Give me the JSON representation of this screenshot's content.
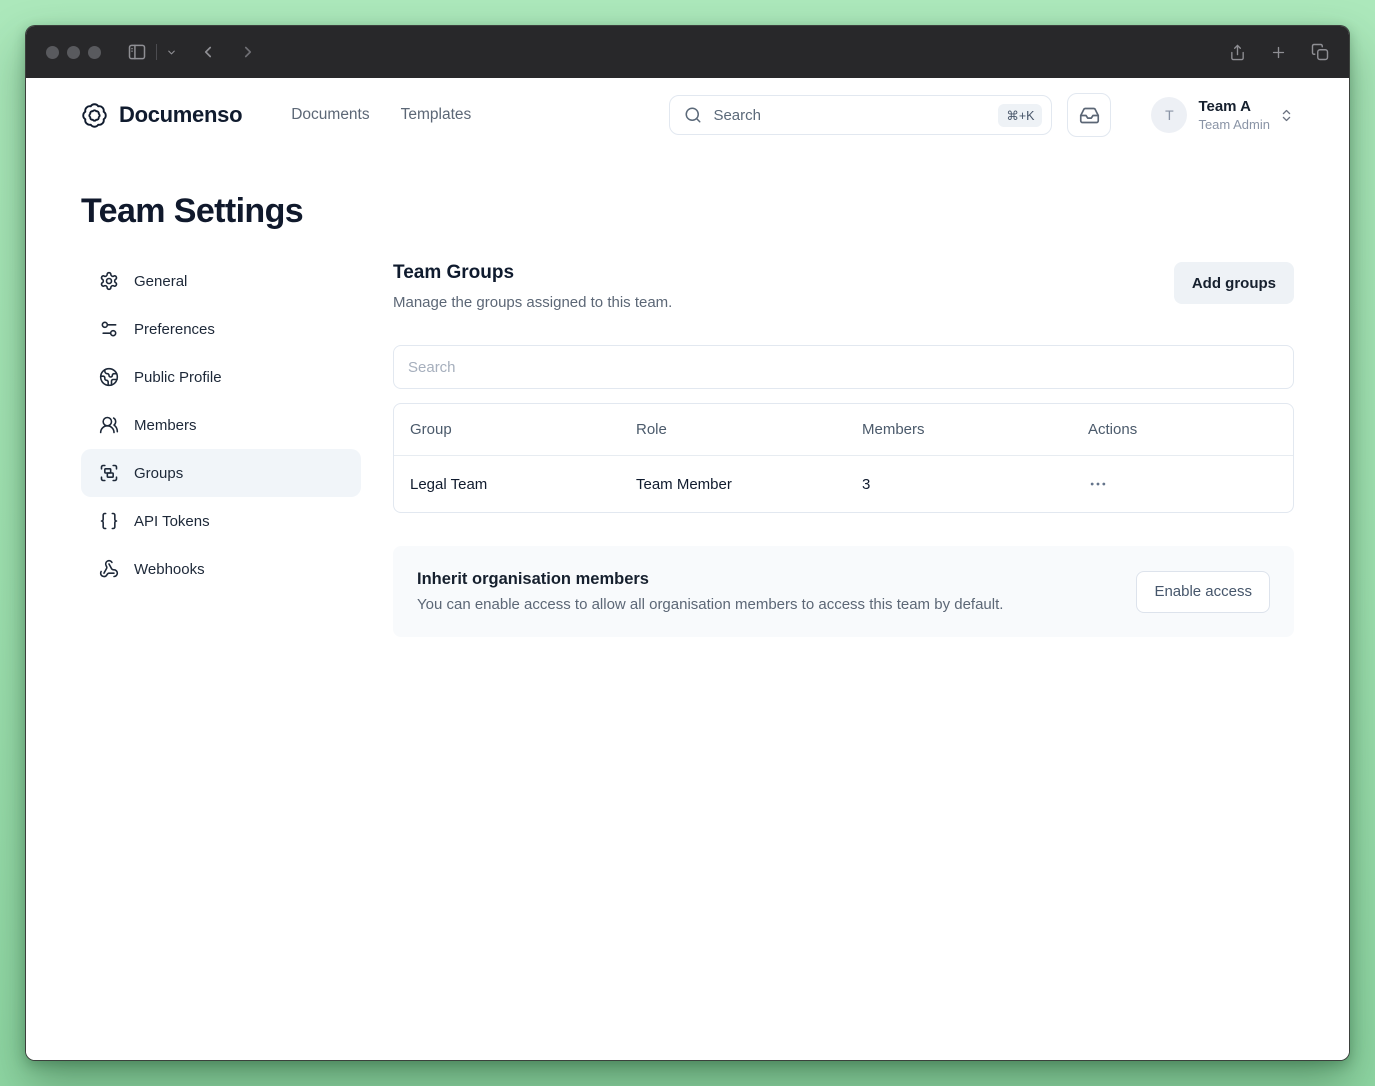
{
  "colors": {
    "desktop_background": "#a0e2b1",
    "titlebar": "#28282a",
    "brand_navy": "#101b2e",
    "muted_text": "#5c6776",
    "selected_item_bg": "#f1f5f9",
    "panel_bg": "#f8fafc"
  },
  "icons": {
    "titlebar": [
      "sidebar-toggle-icon",
      "chevron-down-icon",
      "back-icon",
      "forward-icon",
      "share-icon",
      "new-tab-icon",
      "tab-overview-icon"
    ],
    "header": [
      "documenso-badge-icon",
      "search-icon",
      "inbox-icon",
      "chevrons-up-down-icon"
    ],
    "sidebar": [
      "gear-icon",
      "sliders-icon",
      "globe-icon",
      "users-icon",
      "group-icon",
      "braces-icon",
      "webhook-icon"
    ],
    "table": [
      "more-horizontal-icon"
    ]
  },
  "header": {
    "brand": "Documenso",
    "nav": [
      {
        "label": "Documents"
      },
      {
        "label": "Templates"
      }
    ],
    "search": {
      "placeholder": "Search",
      "shortcut": "⌘+K"
    },
    "account": {
      "initial": "T",
      "name": "Team A",
      "role": "Team Admin"
    }
  },
  "page": {
    "title": "Team Settings"
  },
  "sidebar": {
    "items": [
      {
        "label": "General",
        "icon": "gear-icon",
        "active": false
      },
      {
        "label": "Preferences",
        "icon": "sliders-icon",
        "active": false
      },
      {
        "label": "Public Profile",
        "icon": "globe-icon",
        "active": false
      },
      {
        "label": "Members",
        "icon": "users-icon",
        "active": false
      },
      {
        "label": "Groups",
        "icon": "group-icon",
        "active": true
      },
      {
        "label": "API Tokens",
        "icon": "braces-icon",
        "active": false
      },
      {
        "label": "Webhooks",
        "icon": "webhook-icon",
        "active": false
      }
    ]
  },
  "main": {
    "section_title": "Team Groups",
    "section_subtitle": "Manage the groups assigned to this team.",
    "add_button": "Add groups",
    "search_placeholder": "Search",
    "table": {
      "columns": [
        "Group",
        "Role",
        "Members",
        "Actions"
      ],
      "rows": [
        {
          "group": "Legal Team",
          "role": "Team Member",
          "members": "3",
          "actions_icon": "more-horizontal-icon"
        }
      ]
    },
    "inherit": {
      "title": "Inherit organisation members",
      "description": "You can enable access to allow all organisation members to access this team by default.",
      "button": "Enable access"
    }
  }
}
